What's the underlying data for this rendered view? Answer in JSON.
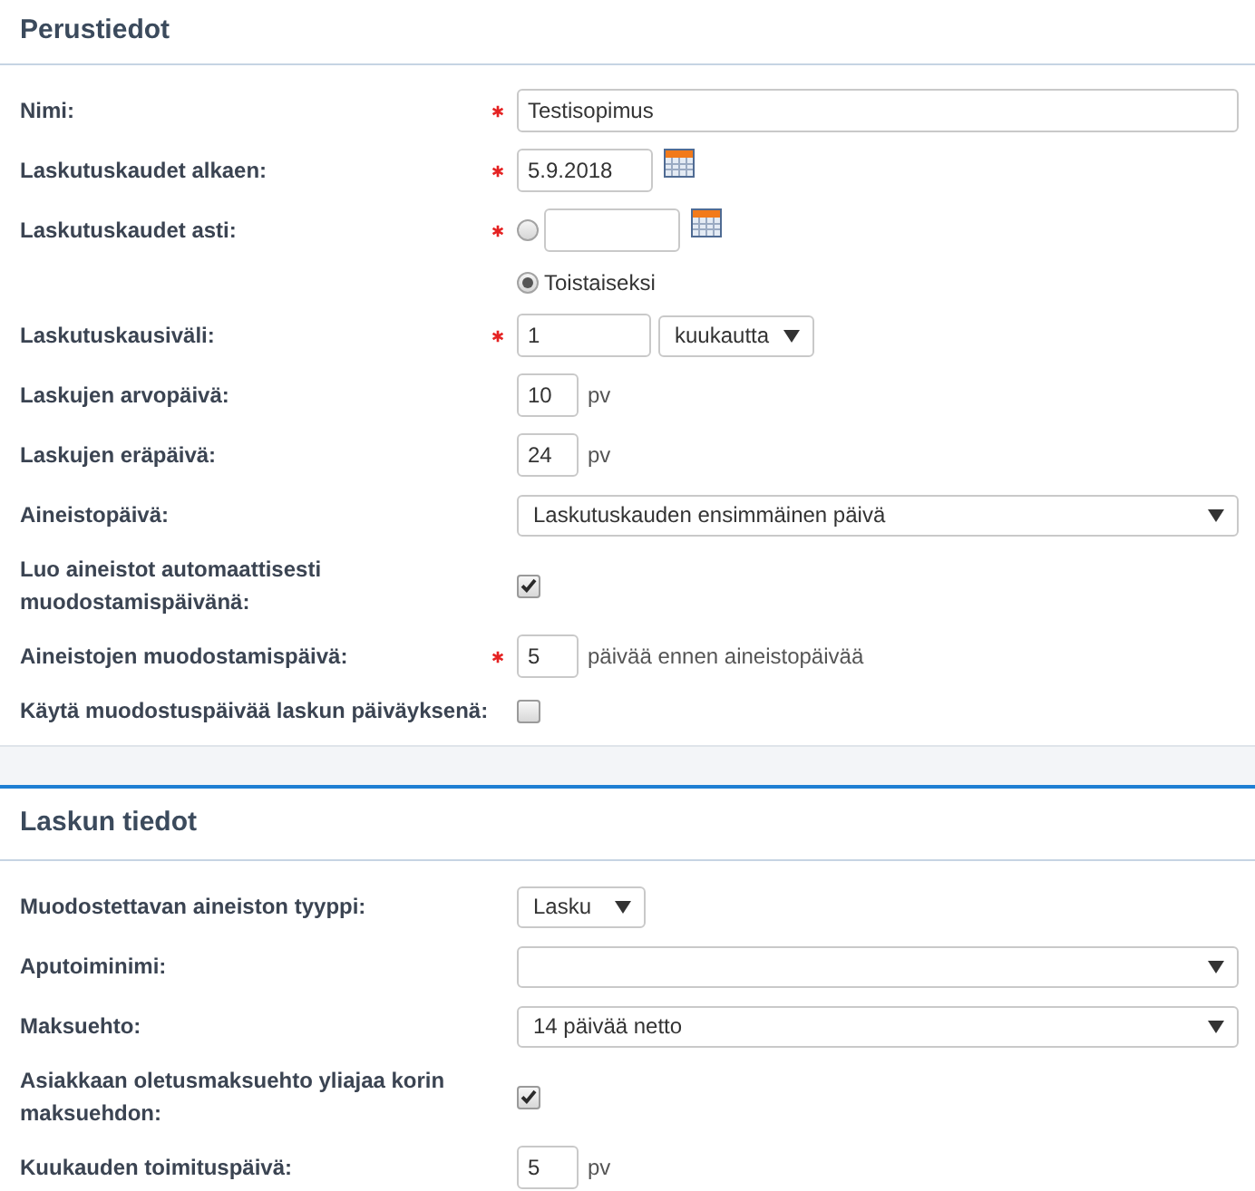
{
  "sections": [
    {
      "title": "Perustiedot",
      "fields": [
        {
          "kind": "text",
          "label": "Nimi:",
          "required": true,
          "value": "Testisopimus"
        },
        {
          "kind": "date",
          "label": "Laskutuskaudet alkaen:",
          "required": true,
          "value": "5.9.2018"
        },
        {
          "kind": "end_date",
          "label": "Laskutuskaudet asti:",
          "required": true,
          "options": [
            {
              "kind": "date",
              "selected": false
            },
            {
              "kind": "label",
              "label": "Toistaiseksi",
              "selected": true
            }
          ]
        },
        {
          "kind": "interval",
          "label": "Laskutuskausiväli:",
          "required": true,
          "value": "1",
          "unit": "kuukautta"
        },
        {
          "kind": "number",
          "label": "Laskujen arvopäivä:",
          "required": false,
          "value": "10",
          "suffix": "pv"
        },
        {
          "kind": "number",
          "label": "Laskujen eräpäivä:",
          "required": false,
          "value": "24",
          "suffix": "pv"
        },
        {
          "kind": "select",
          "label": "Aineistopäivä:",
          "required": false,
          "value": "Laskutuskauden ensimmäinen päivä"
        },
        {
          "kind": "checkbox",
          "label": "Luo aineistot automaattisesti muodostamispäivänä:",
          "required": false,
          "checked": true
        },
        {
          "kind": "number",
          "label": "Aineistojen muodostamispäivä:",
          "required": true,
          "value": "5",
          "suffix": "päivää ennen aineistopäivää"
        },
        {
          "kind": "checkbox",
          "label": "Käytä muodostuspäivää laskun päiväyksenä:",
          "required": false,
          "checked": false
        }
      ]
    },
    {
      "title": "Laskun tiedot",
      "fields": [
        {
          "kind": "dropdown",
          "label": "Muodostettavan aineiston tyyppi:",
          "required": false,
          "value": "Lasku"
        },
        {
          "kind": "select",
          "label": "Aputoiminimi:",
          "required": false
        },
        {
          "kind": "select",
          "label": "Maksuehto:",
          "required": false,
          "value": "14 päivää netto"
        },
        {
          "kind": "checkbox",
          "label": "Asiakkaan oletusmaksuehto yliajaa korin maksuehdon:",
          "required": false,
          "checked": true
        },
        {
          "kind": "number",
          "label": "Kuukauden toimituspäivä:",
          "required": false,
          "value": "5",
          "suffix": "pv"
        }
      ]
    }
  ]
}
